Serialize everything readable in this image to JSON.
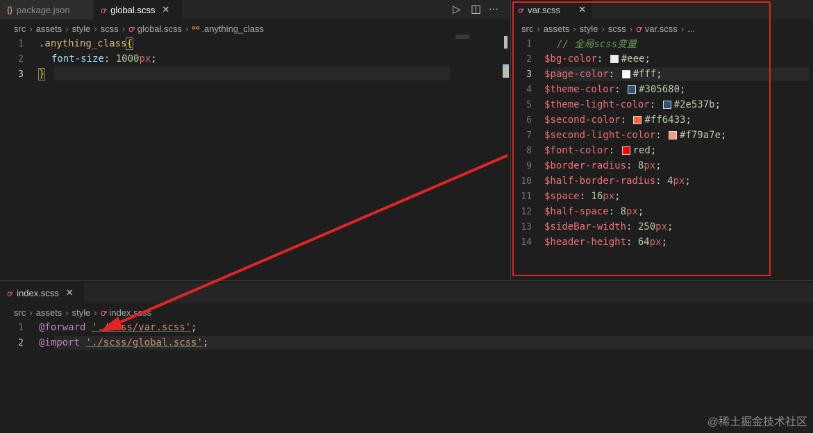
{
  "left_tabs": [
    {
      "icon": "{}",
      "label": "package.json",
      "active": false
    },
    {
      "icon": "ꝍ",
      "label": "global.scss",
      "active": true,
      "close": "✕"
    }
  ],
  "right_tabs": [
    {
      "icon": "ꝍ",
      "label": "var.scss",
      "active": true,
      "close": "✕"
    }
  ],
  "bottom_tabs": [
    {
      "icon": "ꝍ",
      "label": "index.scss",
      "active": true,
      "close": "✕"
    }
  ],
  "toolbar": {
    "run": "▷",
    "split": "◫",
    "more": "···"
  },
  "crumbs": {
    "global": [
      "src",
      "assets",
      "style",
      "scss",
      "global.scss",
      ".anything_class"
    ],
    "var": [
      "src",
      "assets",
      "style",
      "scss",
      "var.scss",
      "..."
    ],
    "index": [
      "src",
      "assets",
      "style",
      "index.scss"
    ]
  },
  "global_code": {
    "l1": {
      "num": "1",
      "selector": ".anything_class",
      "brace": "{"
    },
    "l2": {
      "num": "2",
      "prop": "font-size",
      "colon": ": ",
      "value": "1000",
      "unit": "px",
      "semi": ";"
    },
    "l3": {
      "num": "3",
      "brace": "}"
    }
  },
  "var_code": [
    {
      "num": "1",
      "comment": "// 全局scss变量"
    },
    {
      "num": "2",
      "name": "$bg-color",
      "value": "#eee",
      "swatch": "#eeeeee"
    },
    {
      "num": "3",
      "name": "$page-color",
      "value": "#fff",
      "swatch": "#ffffff"
    },
    {
      "num": "4",
      "name": "$theme-color",
      "value": "#305680",
      "swatch": "#305680"
    },
    {
      "num": "5",
      "name": "$theme-light-color",
      "value": "#2e537b",
      "swatch": "#2e537b"
    },
    {
      "num": "6",
      "name": "$second-color",
      "value": "#ff6433",
      "swatch": "#ff6433"
    },
    {
      "num": "7",
      "name": "$second-light-color",
      "value": "#f79a7e",
      "swatch": "#f79a7e"
    },
    {
      "num": "8",
      "name": "$font-color",
      "value": "red",
      "swatch": "#ff0000"
    },
    {
      "num": "9",
      "name": "$border-radius",
      "value": "8",
      "unit": "px"
    },
    {
      "num": "10",
      "name": "$half-border-radius",
      "value": "4",
      "unit": "px"
    },
    {
      "num": "11",
      "name": "$space",
      "value": "16",
      "unit": "px"
    },
    {
      "num": "12",
      "name": "$half-space",
      "value": "8",
      "unit": "px"
    },
    {
      "num": "13",
      "name": "$sideBar-width",
      "value": "250",
      "unit": "px"
    },
    {
      "num": "14",
      "name": "$header-height",
      "value": "64",
      "unit": "px"
    }
  ],
  "index_code": [
    {
      "num": "1",
      "kw": "@forward",
      "str": "'./scss/var.scss'",
      "semi": ";"
    },
    {
      "num": "2",
      "kw": "@import",
      "str": "'./scss/global.scss'",
      "semi": ";"
    }
  ],
  "watermark": "@稀土掘金技术社区",
  "colors": {
    "annotation": "#e02424"
  }
}
